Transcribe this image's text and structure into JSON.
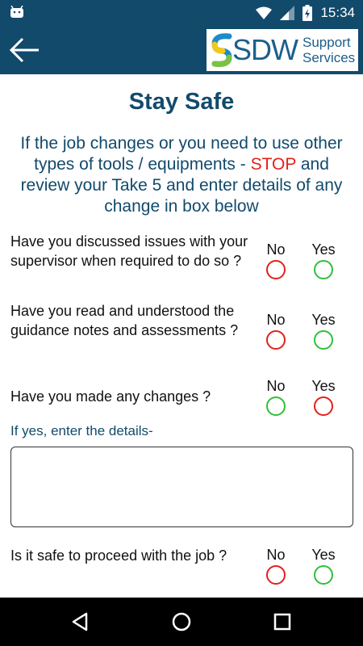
{
  "status_bar": {
    "time": "15:34"
  },
  "logo": {
    "brand": "SDW",
    "tag_line1": "Support",
    "tag_line2": "Services"
  },
  "page": {
    "title": "Stay Safe",
    "instruction_part1": "If the job changes or you need to use other types of tools / equipments - ",
    "instruction_stop": "STOP",
    "instruction_part2": " and review your Take 5 and enter details of any change in box below"
  },
  "options": {
    "no": "No",
    "yes": "Yes"
  },
  "questions": [
    {
      "text": "Have you discussed issues with your supervisor when required to do so ?",
      "no_color": "#e3201b",
      "yes_color": "#2fbf3a"
    },
    {
      "text": "Have you read and understood the guidance notes and assessments ?",
      "no_color": "#e3201b",
      "yes_color": "#2fbf3a"
    },
    {
      "text": "Have you made any changes ?",
      "no_color": "#2fbf3a",
      "yes_color": "#e3201b"
    },
    {
      "text": "Is it safe to proceed with the job ?",
      "no_color": "#e3201b",
      "yes_color": "#2fbf3a"
    }
  ],
  "details": {
    "label": "If yes, enter the details-",
    "value": ""
  },
  "colors": {
    "header": "#124a6c",
    "stop": "#e3201b",
    "positive": "#2fbf3a",
    "negative": "#e3201b"
  }
}
